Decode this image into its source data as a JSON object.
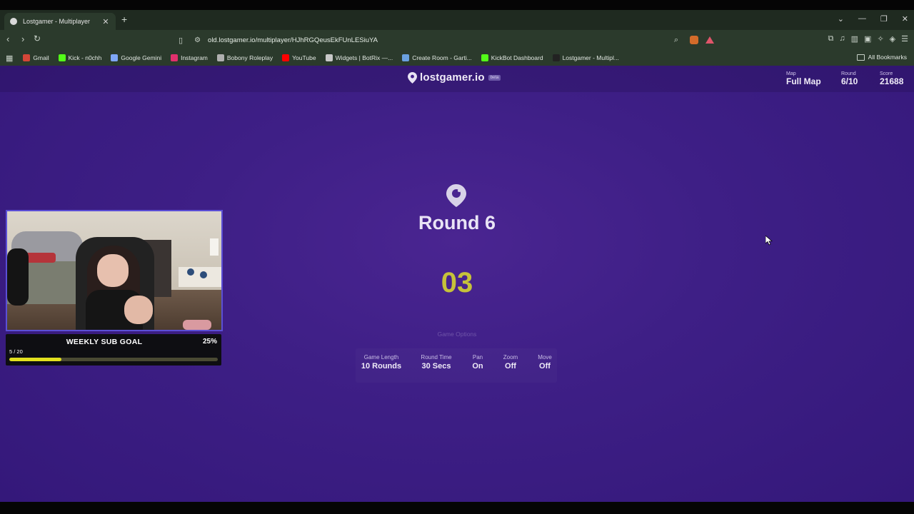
{
  "browser": {
    "tab_title": "Lostgamer - Multiplayer",
    "url": "old.lostgamer.io/multiplayer/HJhRGQeusEkFUnLESiuYA",
    "bookmarks": [
      {
        "label": "Gmail",
        "color": "#d44638"
      },
      {
        "label": "Kick - n0chh",
        "color": "#53fc18"
      },
      {
        "label": "Google Gemini",
        "color": "#7ea6f6"
      },
      {
        "label": "Instagram",
        "color": "#e1306c"
      },
      {
        "label": "Bobony Roleplay",
        "color": "#b0b0b0"
      },
      {
        "label": "YouTube",
        "color": "#ff0000"
      },
      {
        "label": "Widgets | BotRix —...",
        "color": "#c8c8c8"
      },
      {
        "label": "Create Room - Garti...",
        "color": "#6aa0e0"
      },
      {
        "label": "KickBot Dashboard",
        "color": "#53fc18"
      },
      {
        "label": "Lostgamer - Multipl...",
        "color": "#222222"
      }
    ],
    "all_bookmarks": "All Bookmarks"
  },
  "game": {
    "logo_text": "lostgamer.io",
    "beta": "beta",
    "map_label": "Map",
    "map_value": "Full Map",
    "round_label": "Round",
    "round_value": "6/10",
    "score_label": "Score",
    "score_value": "21688",
    "round_title": "Round 6",
    "countdown": "03",
    "options_title": "Game Options",
    "options": [
      {
        "label": "Game Length",
        "value": "10 Rounds"
      },
      {
        "label": "Round Time",
        "value": "30 Secs"
      },
      {
        "label": "Pan",
        "value": "On"
      },
      {
        "label": "Zoom",
        "value": "Off"
      },
      {
        "label": "Move",
        "value": "Off"
      }
    ],
    "accent_color": "#c6c23a"
  },
  "overlay": {
    "goal_label": "WEEKLY SUB GOAL",
    "goal_percent": "25%",
    "goal_count": "5 / 20",
    "goal_progress": 0.25
  }
}
